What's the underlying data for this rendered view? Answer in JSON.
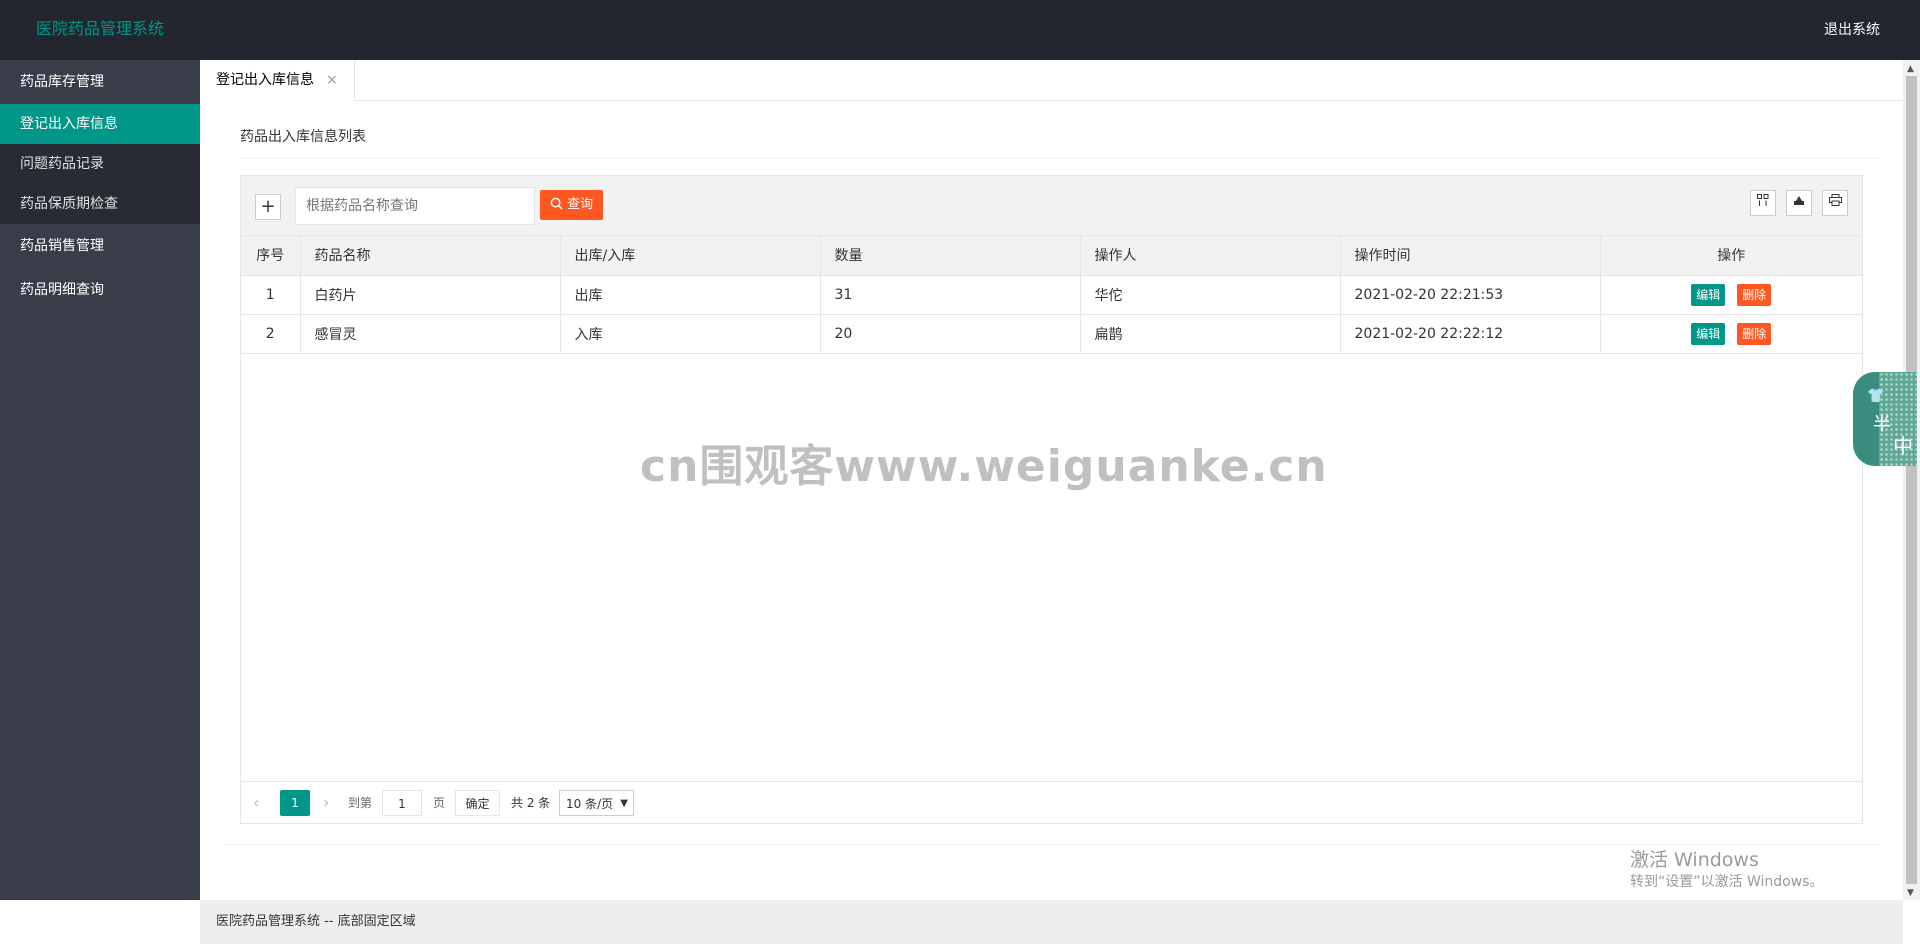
{
  "header": {
    "logo": "医院药品管理系统",
    "logout": "退出系统"
  },
  "sidebar": {
    "group1": "药品库存管理",
    "sub_items": [
      "登记出入库信息",
      "问题药品记录",
      "药品保质期检查"
    ],
    "group2": "药品销售管理",
    "group3": "药品明细查询"
  },
  "tabs": [
    {
      "label": "登记出入库信息",
      "close": "×"
    }
  ],
  "card": {
    "title": "药品出入库信息列表"
  },
  "toolbar": {
    "add": "+",
    "search_placeholder": "根据药品名称查询",
    "search_button": "查询"
  },
  "table": {
    "columns": [
      "序号",
      "药品名称",
      "出库/入库",
      "数量",
      "操作人",
      "操作时间",
      "操作"
    ],
    "rows": [
      [
        "1",
        "白药片",
        "出库",
        "31",
        "华佗",
        "2021-02-20 22:21:53"
      ],
      [
        "2",
        "感冒灵",
        "入库",
        "20",
        "扁鹊",
        "2021-02-20 22:22:12"
      ]
    ],
    "edit_label": "编辑",
    "delete_label": "删除"
  },
  "pager": {
    "prev": "‹",
    "current": "1",
    "next": "›",
    "goto_label": "到第",
    "goto_value": "1",
    "page_unit": "页",
    "confirm": "确定",
    "total": "共 2 条",
    "page_size": "10 条/页"
  },
  "watermark": "cn围观客www.weiguanke.cn",
  "activation": {
    "line1": "激活 Windows",
    "line2": "转到“设置”以激活 Windows。"
  },
  "footer": {
    "text": "医院药品管理系统 -- 底部固定区域"
  },
  "widget": {
    "char1": "半",
    "char2": "中"
  },
  "colors": {
    "accent": "#009688",
    "danger": "#ff5722",
    "header_bg": "#23262e",
    "sidebar_bg": "#393d49"
  }
}
